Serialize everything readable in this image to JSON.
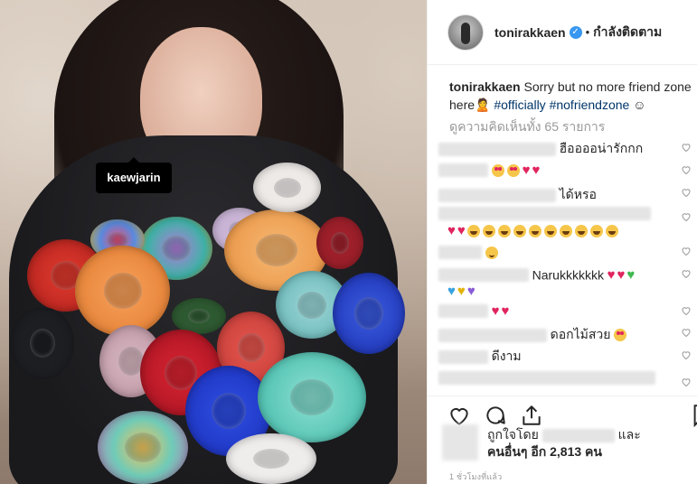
{
  "photo": {
    "tag_label": "kaewjarin"
  },
  "header": {
    "username": "tonirakkaen",
    "verified_icon": "verified-badge-icon",
    "separator": "•",
    "follow_status": "กำลังติดตาม"
  },
  "caption": {
    "username": "tonirakkaen",
    "text": "Sorry but no more friend zone here",
    "emoji": "🙎",
    "hashtags": [
      "#officially",
      "#nofriendzone"
    ],
    "trailing_emoji": "☺"
  },
  "view_all_comments": "ดูความคิดเห็นทั้ง 65 รายการ",
  "comments": [
    {
      "text": "ฮืออออน่ารักกก",
      "emojis": []
    },
    {
      "text": "",
      "emojis": [
        "love-eyes",
        "love-eyes",
        "red-heart",
        "red-heart"
      ]
    },
    {
      "text": "ได้หรอ",
      "emojis": []
    },
    {
      "text": "",
      "emojis": [
        "red-heart",
        "red-heart",
        "laugh",
        "laugh",
        "laugh",
        "laugh",
        "laugh",
        "laugh",
        "laugh",
        "laugh",
        "laugh",
        "laugh"
      ]
    },
    {
      "text": "",
      "emojis": [
        "smile"
      ]
    },
    {
      "text": "Narukkkkkkk",
      "emojis": [
        "red-heart",
        "red-heart",
        "green-heart",
        "blue-heart",
        "yellow-heart",
        "purple-heart"
      ]
    },
    {
      "text": "",
      "emojis": [
        "red-heart",
        "red-heart"
      ]
    },
    {
      "text": "ดอกไม้สวย",
      "emojis": [
        "love-eyes"
      ]
    },
    {
      "text": "ดีงาม",
      "emojis": []
    },
    {
      "text": "",
      "emojis": []
    }
  ],
  "likes": {
    "liked_by_prefix": "ถูกใจโดย",
    "and": "และ",
    "others_prefix": "คนอื่นๆ อีก",
    "others_count": "2,813",
    "others_suffix": "คน"
  },
  "timestamp": "1 ชั่วโมงที่แล้ว",
  "colors": {
    "hashtag": "#003569",
    "verified": "#3897f0",
    "heart_red": "#e0245e",
    "muted": "#999999"
  }
}
